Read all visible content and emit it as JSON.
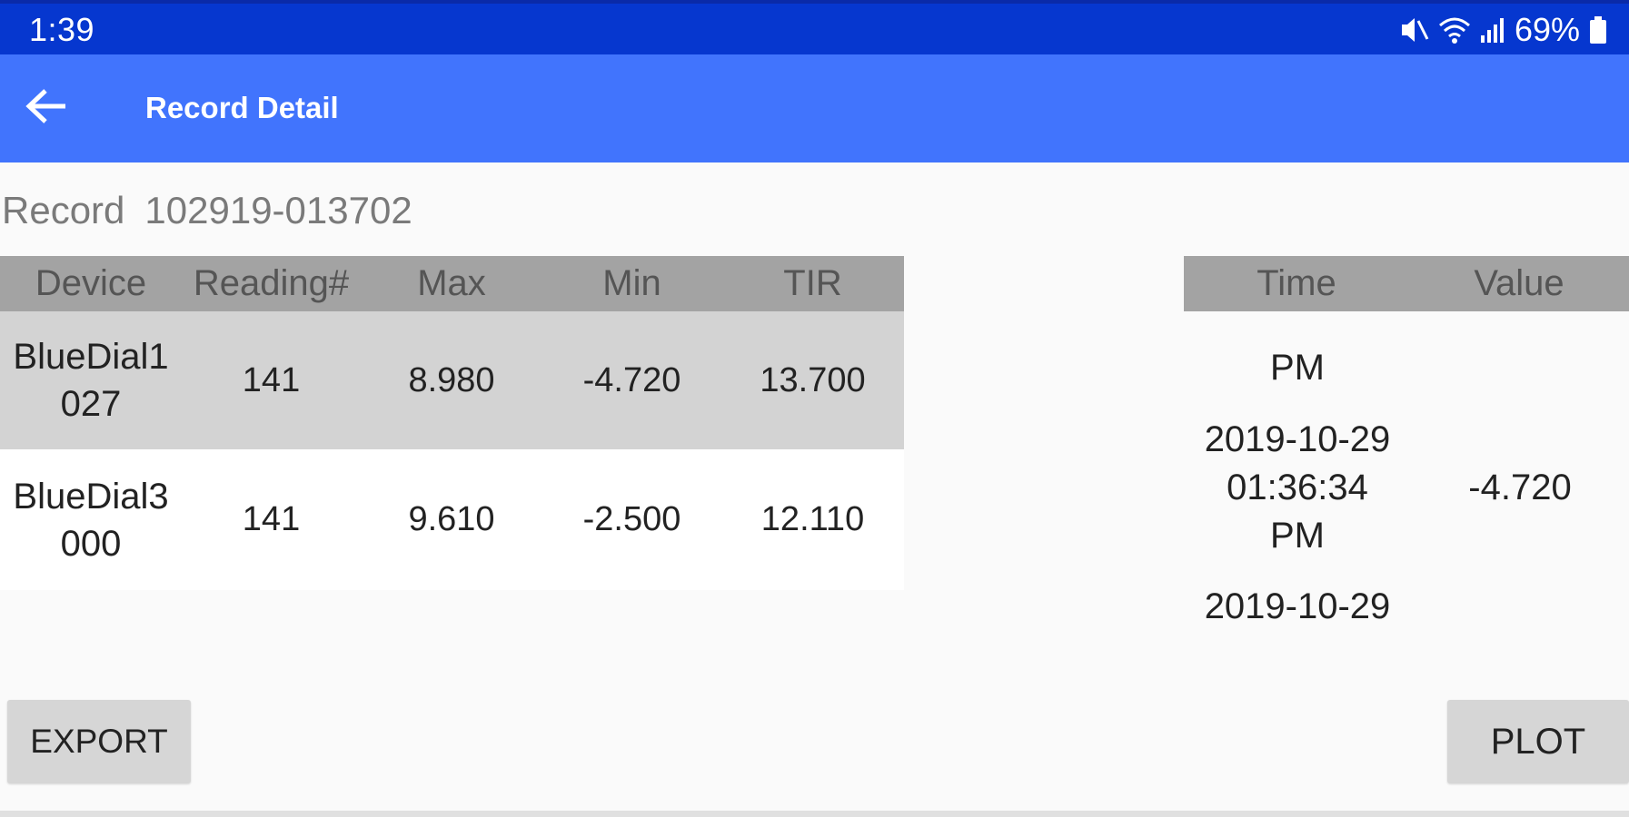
{
  "status_bar": {
    "time": "1:39",
    "battery": "69%",
    "icons": [
      "mute-icon",
      "wifi-icon",
      "signal-icon",
      "battery-icon"
    ]
  },
  "app_bar": {
    "title": "Record Detail",
    "back_icon": "arrow-left-icon",
    "color": "#4174fd"
  },
  "record": {
    "label": "Record",
    "id": "102919-013702"
  },
  "device_table": {
    "headers": [
      "Device",
      "Reading#",
      "Max",
      "Min",
      "TIR"
    ],
    "rows": [
      {
        "device_line1": "BlueDial1",
        "device_line2": "027",
        "reading": "141",
        "max": "8.980",
        "min": "-4.720",
        "tir": "13.700"
      },
      {
        "device_line1": "BlueDial3",
        "device_line2": "000",
        "reading": "141",
        "max": "9.610",
        "min": "-2.500",
        "tir": "12.110"
      }
    ]
  },
  "readings_table": {
    "headers": [
      "Time",
      "Value"
    ],
    "items": [
      {
        "line1": "PM",
        "line2": "",
        "line3": "",
        "value": ""
      },
      {
        "line1": "2019-10-29",
        "line2": "01:36:34",
        "line3": "PM",
        "value": "-4.720"
      },
      {
        "line1": "2019-10-29",
        "line2": "",
        "line3": "",
        "value": ""
      }
    ]
  },
  "buttons": {
    "export": "EXPORT",
    "plot": "PLOT"
  }
}
